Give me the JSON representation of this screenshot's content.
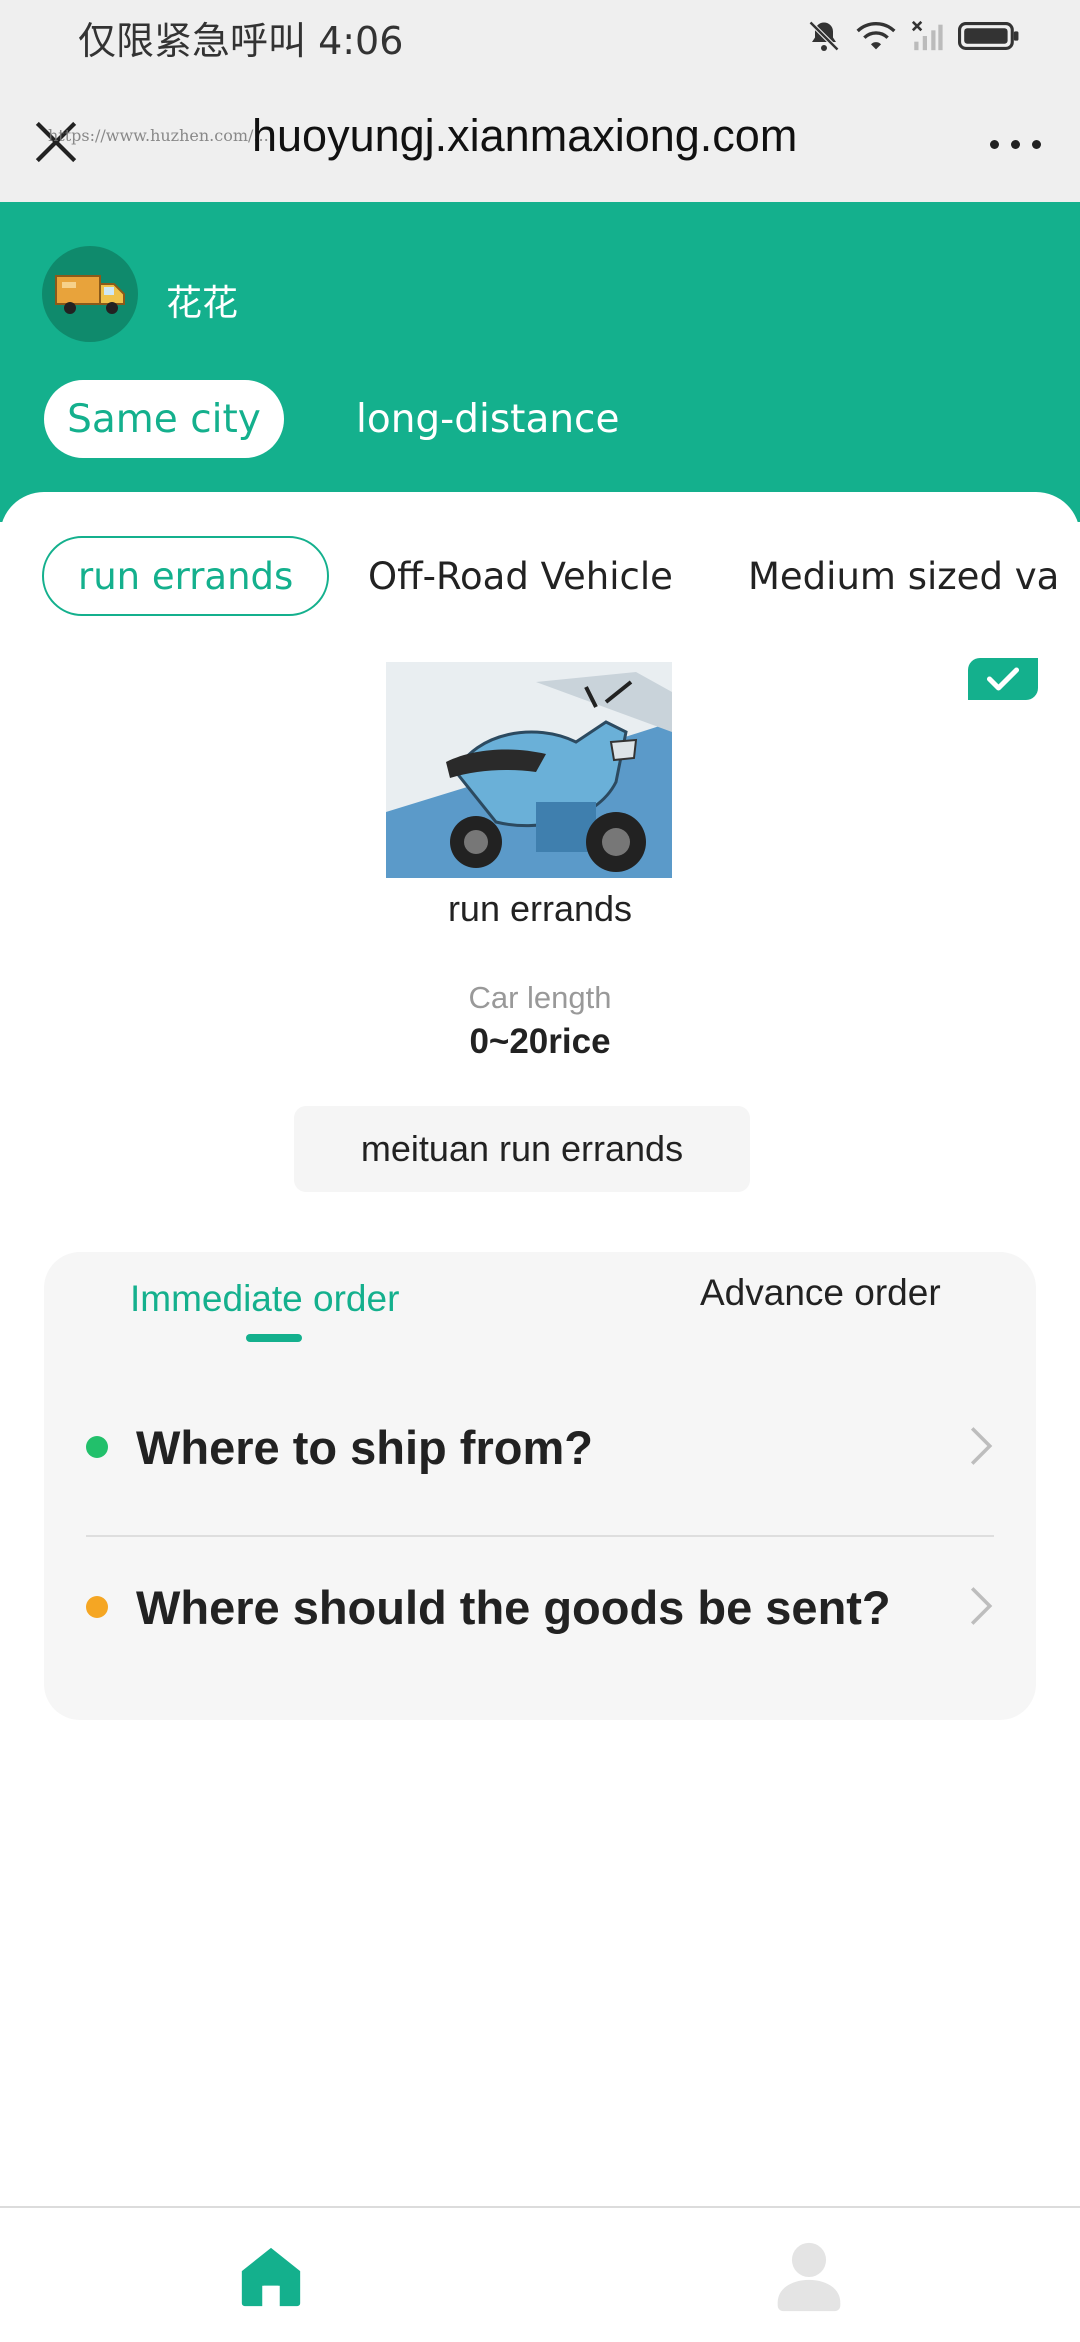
{
  "status_bar": {
    "carrier_time": "仅限紧急呼叫 4:06",
    "icons": [
      "mute-bell-icon",
      "wifi-icon",
      "no-signal-icon",
      "battery-icon"
    ]
  },
  "browser": {
    "url": "huoyungj.xianmaxiong.com",
    "watermark": "https://www.huzhen.com/...",
    "close_icon": "close-icon",
    "more_icon": "more-dots-icon"
  },
  "header": {
    "username": "花花",
    "tabs": [
      {
        "label": "Same city",
        "active": true
      },
      {
        "label": "long-distance",
        "active": false
      }
    ],
    "accent_color": "#14b08d"
  },
  "vehicle_types": [
    {
      "label": "run errands",
      "active": true
    },
    {
      "label": "Off-Road Vehicle",
      "active": false
    },
    {
      "label": "Medium sized va",
      "active": false
    }
  ],
  "selected_vehicle": {
    "name": "run errands",
    "car_length_label": "Car length",
    "car_length_value": "0~20rice",
    "service_tag": "meituan run errands"
  },
  "order": {
    "tabs": [
      {
        "label": "Immediate order",
        "active": true
      },
      {
        "label": "Advance order",
        "active": false
      }
    ],
    "from_prompt": "Where to ship from?",
    "to_prompt": "Where should the goods be sent?",
    "from_dot_color": "#22c06b",
    "to_dot_color": "#f5a623"
  },
  "bottom_nav": {
    "items": [
      {
        "icon": "home-icon",
        "active": true
      },
      {
        "icon": "profile-icon",
        "active": false
      }
    ]
  }
}
